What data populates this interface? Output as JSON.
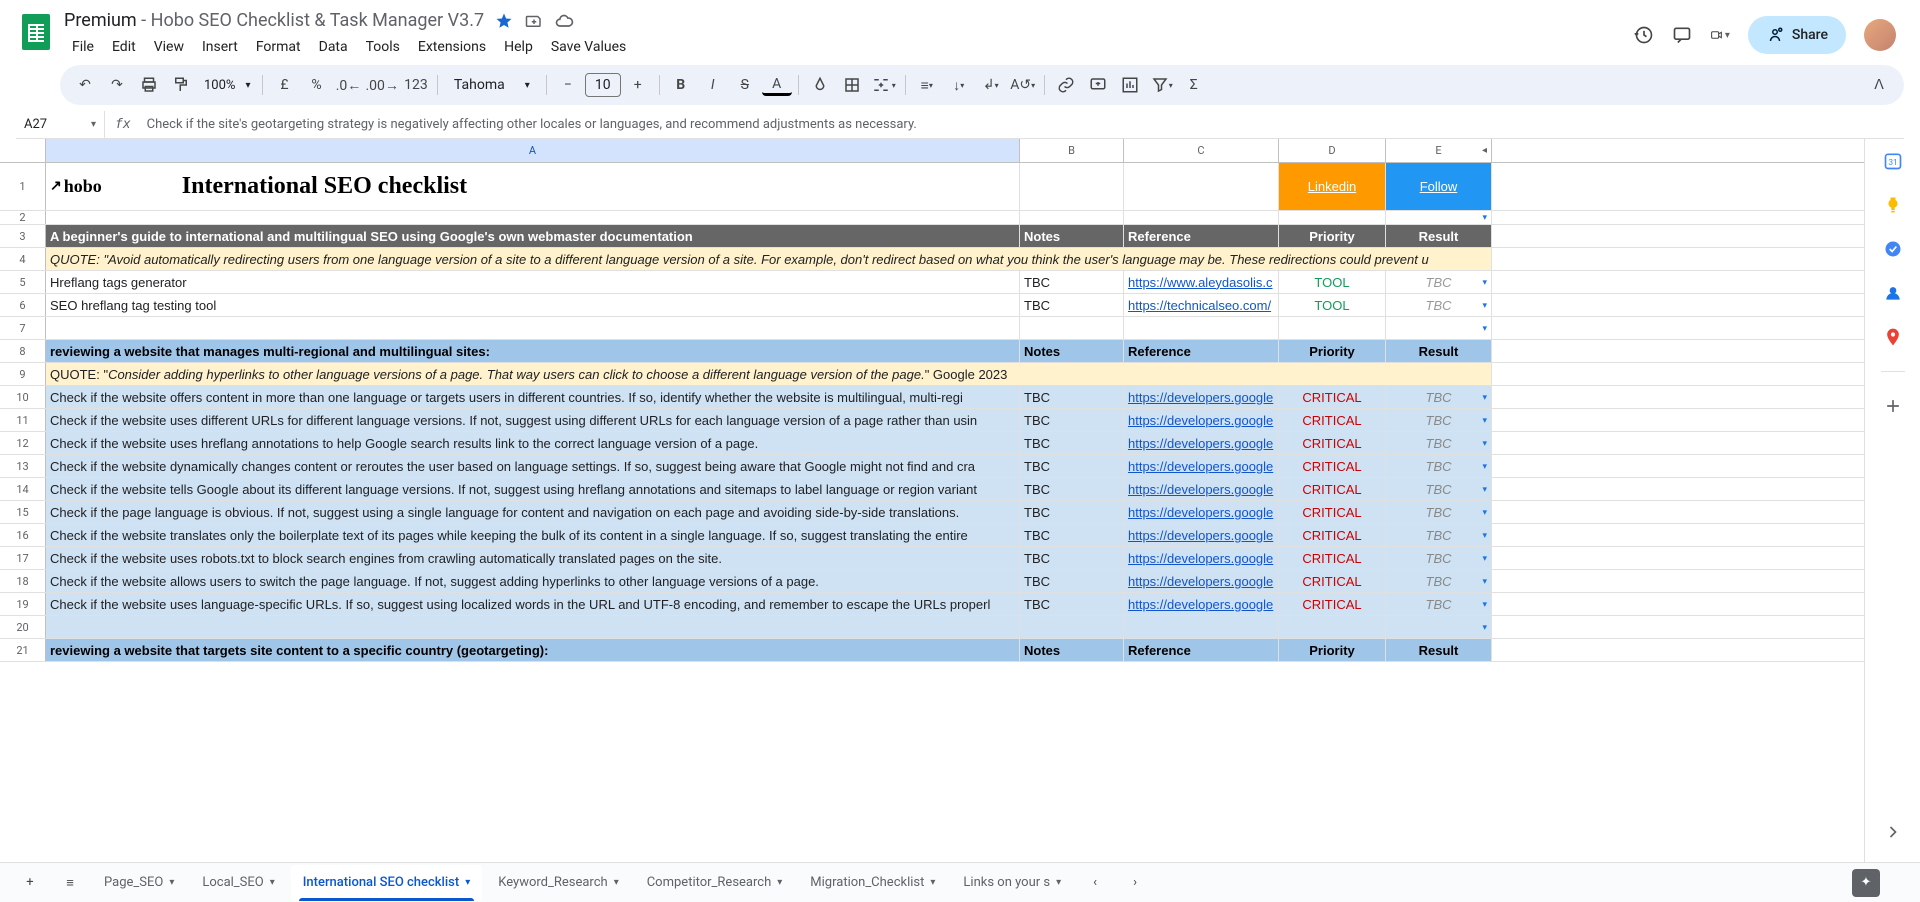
{
  "doc": {
    "title_plain": "Premium",
    "title_suffix": " - Hobo SEO Checklist & Task Manager V3.7"
  },
  "menu": [
    "File",
    "Edit",
    "View",
    "Insert",
    "Format",
    "Data",
    "Tools",
    "Extensions",
    "Help",
    "Save Values"
  ],
  "header_actions": {
    "share": "Share"
  },
  "toolbar": {
    "zoom": "100%",
    "currency": "£",
    "percent": "%",
    "number_fmt": "123",
    "font": "Tahoma",
    "font_size": "10"
  },
  "namebox": "A27",
  "formula": "Check if the site's geotargeting strategy is negatively affecting other locales or languages, and recommend adjustments as necessary.",
  "columns": [
    "A",
    "B",
    "C",
    "D",
    "E"
  ],
  "header_links": {
    "linkedin": "Linkedin",
    "follow": "Follow"
  },
  "title_cell": {
    "logo": "hobo",
    "text": "International SEO checklist"
  },
  "band1": {
    "a": "A beginner's guide to international and multilingual SEO using Google's own webmaster documentation",
    "b": "Notes",
    "c": "Reference",
    "d": "Priority",
    "e": "Result"
  },
  "quote1": "QUOTE: \"Avoid automatically redirecting users from one language version of a site to a different language version of a site. For example, don't redirect based on what you think the user's language may be. These redirections could prevent u",
  "rows_white": [
    {
      "n": "5",
      "a": "Hreflang tags generator",
      "b": "TBC",
      "c": "https://www.aleydasolis.c",
      "d": "TOOL",
      "e": "TBC"
    },
    {
      "n": "6",
      "a": "SEO hreflang tag testing tool",
      "b": "TBC",
      "c": "https://technicalseo.com/",
      "d": "TOOL",
      "e": "TBC"
    }
  ],
  "section1": {
    "a": "reviewing a website that manages multi-regional and multilingual sites:",
    "b": "Notes",
    "c": "Reference",
    "d": "Priority",
    "e": "Result"
  },
  "quote2_prefix": "QUOTE: \"",
  "quote2_italic": "Consider adding hyperlinks to other language versions of a page. That way users can click to choose a different language version of the page.",
  "quote2_suffix": "\" Google 2023",
  "items": [
    {
      "n": "10",
      "a": "Check if the website offers content in more than one language or targets users in different countries. If so, identify whether the website is multilingual, multi-regi",
      "b": "TBC",
      "c": "https://developers.google",
      "d": "CRITICAL",
      "e": "TBC"
    },
    {
      "n": "11",
      "a": "Check if the website uses different URLs for different language versions. If not, suggest using different URLs for each language version of a page rather than usin",
      "b": "TBC",
      "c": "https://developers.google",
      "d": "CRITICAL",
      "e": "TBC"
    },
    {
      "n": "12",
      "a": "Check if the website uses hreflang annotations to help Google search results link to the correct language version of a page.",
      "b": "TBC",
      "c": "https://developers.google",
      "d": "CRITICAL",
      "e": "TBC"
    },
    {
      "n": "13",
      "a": "Check if the website dynamically changes content or reroutes the user based on language settings. If so, suggest being aware that Google might not find and cra",
      "b": "TBC",
      "c": "https://developers.google",
      "d": "CRITICAL",
      "e": "TBC"
    },
    {
      "n": "14",
      "a": "Check if the website tells Google about its different language versions. If not, suggest using hreflang annotations and sitemaps to label language or region variant",
      "b": "TBC",
      "c": "https://developers.google",
      "d": "CRITICAL",
      "e": "TBC"
    },
    {
      "n": "15",
      "a": "Check if the page language is obvious. If not, suggest using a single language for content and navigation on each page and avoiding side-by-side translations.",
      "b": "TBC",
      "c": "https://developers.google",
      "d": "CRITICAL",
      "e": "TBC"
    },
    {
      "n": "16",
      "a": "Check if the website translates only the boilerplate text of its pages while keeping the bulk of its content in a single language. If so, suggest translating the entire",
      "b": "TBC",
      "c": "https://developers.google",
      "d": "CRITICAL",
      "e": "TBC"
    },
    {
      "n": "17",
      "a": "Check if the website uses robots.txt to block search engines from crawling automatically translated pages on the site.",
      "b": "TBC",
      "c": "https://developers.google",
      "d": "CRITICAL",
      "e": "TBC"
    },
    {
      "n": "18",
      "a": "Check if the website allows users to switch the page language. If not, suggest adding hyperlinks to other language versions of a page.",
      "b": "TBC",
      "c": "https://developers.google",
      "d": "CRITICAL",
      "e": "TBC"
    },
    {
      "n": "19",
      "a": "Check if the website uses language-specific URLs. If so, suggest using localized words in the URL and UTF-8 encoding, and remember to escape the URLs properl",
      "b": "TBC",
      "c": "https://developers.google",
      "d": "CRITICAL",
      "e": "TBC"
    }
  ],
  "section2": {
    "a": "reviewing a website that targets site content to a specific country (geotargeting):",
    "b": "Notes",
    "c": "Reference",
    "d": "Priority",
    "e": "Result"
  },
  "tabs": [
    {
      "label": "Page_SEO",
      "active": false
    },
    {
      "label": "Local_SEO",
      "active": false
    },
    {
      "label": "International SEO checklist",
      "active": true
    },
    {
      "label": "Keyword_Research",
      "active": false
    },
    {
      "label": "Competitor_Research",
      "active": false
    },
    {
      "label": "Migration_Checklist",
      "active": false
    },
    {
      "label": "Links on your s",
      "active": false
    }
  ]
}
